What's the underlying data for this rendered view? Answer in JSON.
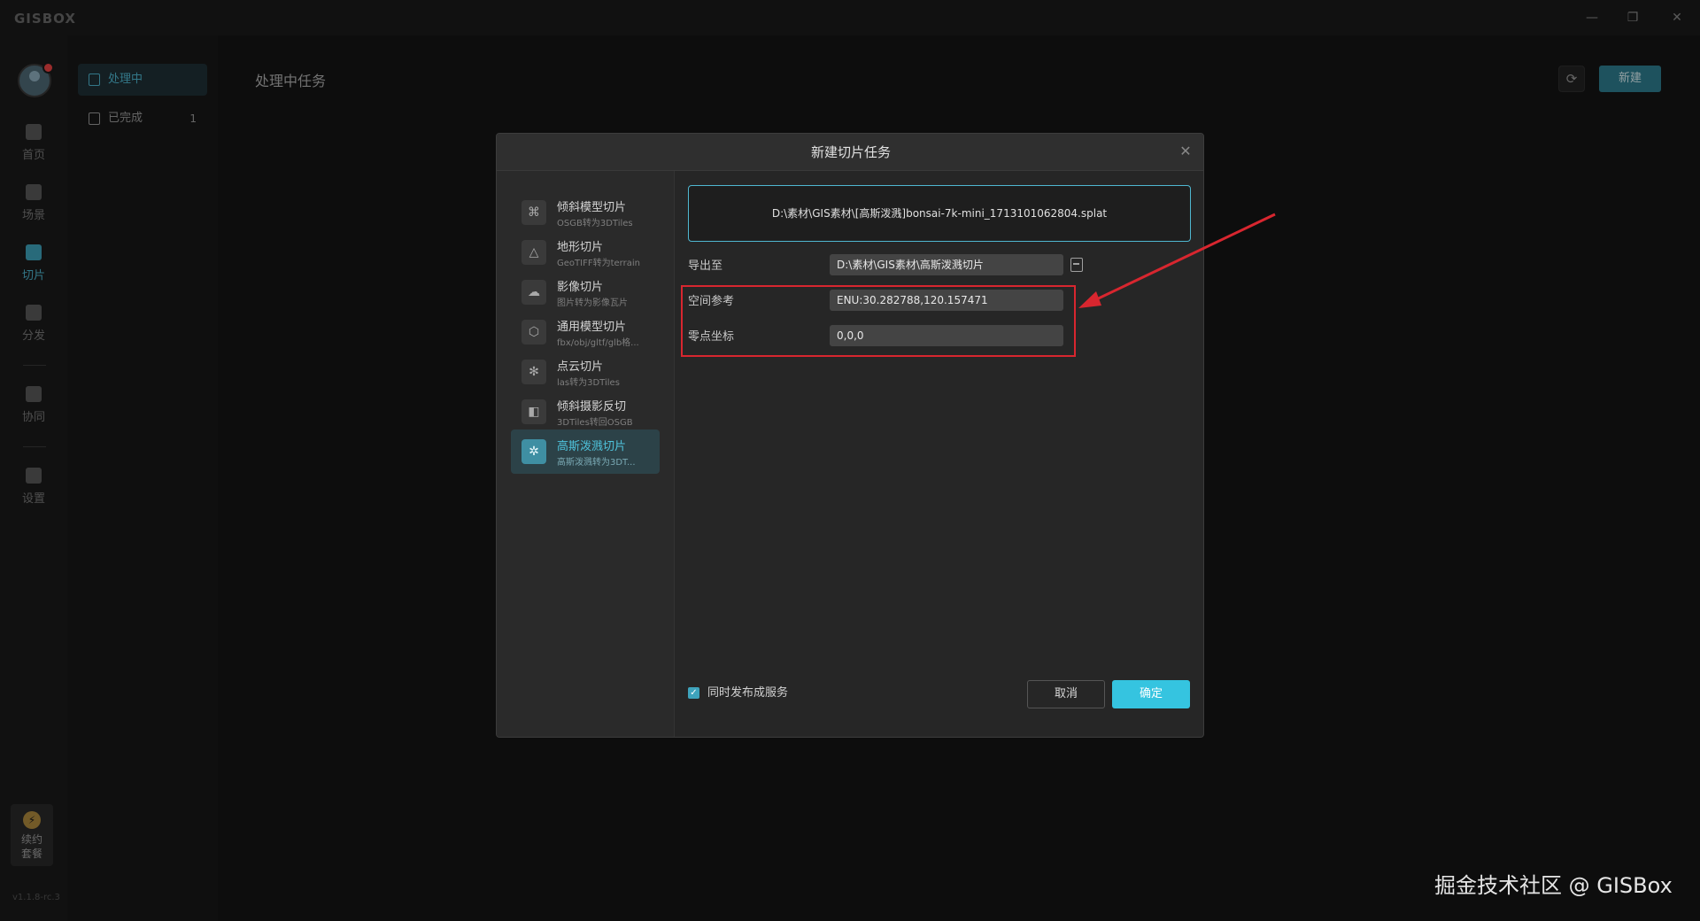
{
  "app": {
    "logo": "GISBOX",
    "version": "v1.1.8-rc.3"
  },
  "window": {
    "minimize": "—",
    "restore": "❐",
    "close": "✕"
  },
  "rail": {
    "items": [
      {
        "label": "首页",
        "icon": "home-icon"
      },
      {
        "label": "场景",
        "icon": "cube-icon"
      },
      {
        "label": "切片",
        "icon": "slice-icon",
        "active": true
      },
      {
        "label": "分发",
        "icon": "share-icon"
      },
      {
        "label": "协同",
        "icon": "lock-icon"
      },
      {
        "label": "设置",
        "icon": "gear-icon"
      }
    ],
    "renew": {
      "line1": "续约",
      "line2": "套餐",
      "icon": "⚡"
    }
  },
  "subnav": {
    "items": [
      {
        "label": "处理中",
        "active": true
      },
      {
        "label": "已完成",
        "count": "1"
      }
    ]
  },
  "main": {
    "title": "处理中任务",
    "new_label": "新建",
    "refresh_icon": "⟳"
  },
  "dialog": {
    "title": "新建切片任务",
    "close": "✕",
    "types": [
      {
        "name": "倾斜模型切片",
        "desc": "OSGB转为3DTiles",
        "icon": "⌘"
      },
      {
        "name": "地形切片",
        "desc": "GeoTIFF转为terrain",
        "icon": "△"
      },
      {
        "name": "影像切片",
        "desc": "图片转为影像瓦片",
        "icon": "☁"
      },
      {
        "name": "通用模型切片",
        "desc": "fbx/obj/gltf/glb格...",
        "icon": "⬡"
      },
      {
        "name": "点云切片",
        "desc": "las转为3DTiles",
        "icon": "✻"
      },
      {
        "name": "倾斜摄影反切",
        "desc": "3DTiles转回OSGB",
        "icon": "◧"
      },
      {
        "name": "高斯泼溅切片",
        "desc": "高斯泼溅转为3DT...",
        "icon": "✲",
        "active": true
      }
    ],
    "file_path": "D:\\素材\\GIS素材\\[高斯泼溅]bonsai-7k-mini_1713101062804.splat",
    "export_label": "导出至",
    "export_value": "D:\\素材\\GIS素材\\高斯泼溅切片",
    "srs_label": "空间参考",
    "srs_value": "ENU:30.282788,120.157471",
    "origin_label": "零点坐标",
    "origin_value": "0,0,0",
    "publish_label": "同时发布成服务",
    "publish_checked": "✓",
    "cancel_label": "取消",
    "ok_label": "确定"
  },
  "watermark": "掘金技术社区 @ GISBox",
  "colors": {
    "accent": "#35c4e0",
    "highlight": "#d8262f",
    "arrow": "#d8262f"
  }
}
